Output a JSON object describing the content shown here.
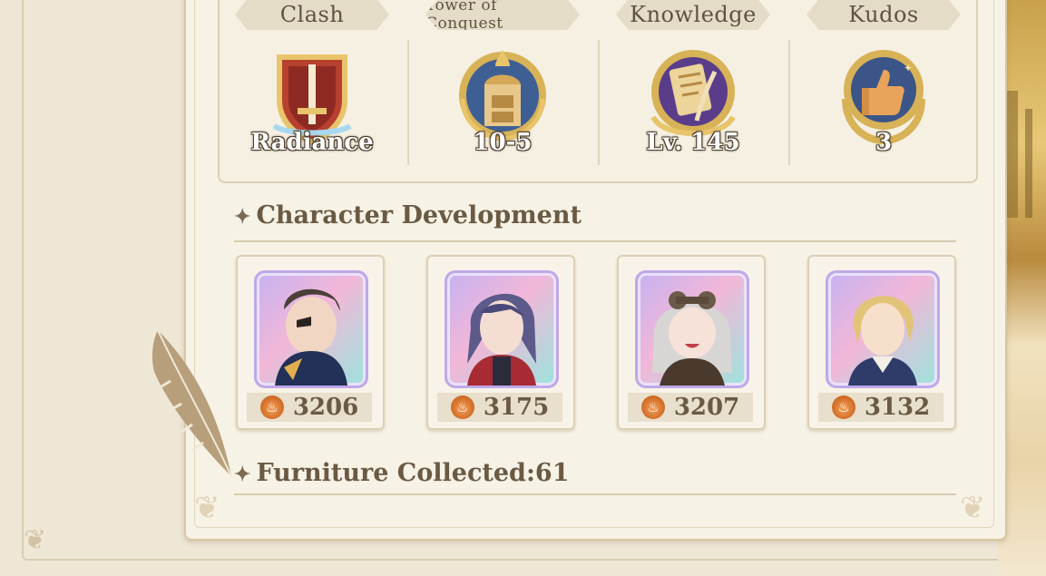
{
  "honors": [
    {
      "title": "Clash",
      "value": "Radiance",
      "icon": "shield-sword-icon"
    },
    {
      "title": "Tower of Conquest",
      "value": "10-5",
      "icon": "tower-icon"
    },
    {
      "title": "Knowledge",
      "value": "Lv. 145",
      "icon": "scroll-quill-icon"
    },
    {
      "title": "Kudos",
      "value": "3",
      "icon": "thumbs-up-icon"
    }
  ],
  "character_development": {
    "heading": "Character Development",
    "characters": [
      {
        "power": "3206",
        "icon": "fire-icon"
      },
      {
        "power": "3175",
        "icon": "fire-icon"
      },
      {
        "power": "3207",
        "icon": "fire-icon"
      },
      {
        "power": "3132",
        "icon": "fire-icon"
      }
    ]
  },
  "furniture": {
    "heading": "Furniture Collected:61"
  },
  "colors": {
    "panel": "#f7f2e6",
    "accent_text": "#6b5a43",
    "fire": "#d4702a",
    "badge_gold": "#d8b257"
  }
}
